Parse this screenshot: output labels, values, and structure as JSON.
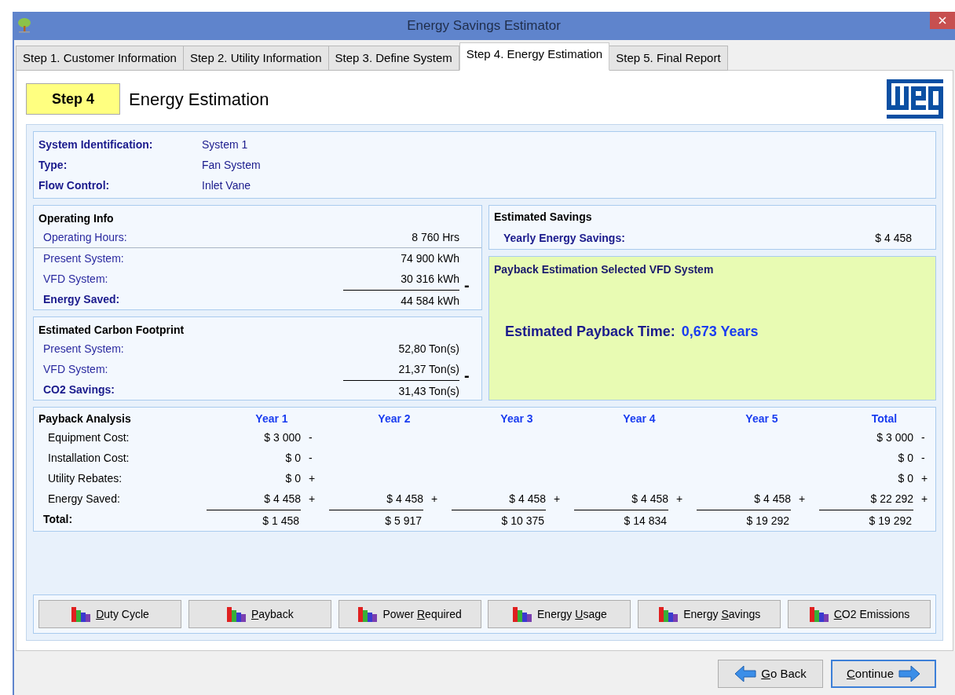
{
  "window": {
    "title": "Energy Savings Estimator"
  },
  "tabs": [
    {
      "label": "Step 1. Customer Information",
      "selected": false
    },
    {
      "label": "Step 2. Utility Information",
      "selected": false
    },
    {
      "label": "Step 3. Define System",
      "selected": false
    },
    {
      "label": "Step 4. Energy Estimation",
      "selected": true
    },
    {
      "label": "Step 5. Final Report",
      "selected": false
    }
  ],
  "header": {
    "badge": "Step 4",
    "title": "Energy Estimation"
  },
  "system": [
    {
      "label": "System Identification:",
      "value": "System 1"
    },
    {
      "label": "Type:",
      "value": "Fan System"
    },
    {
      "label": "Flow Control:",
      "value": "Inlet Vane"
    }
  ],
  "operating_info": {
    "title": "Operating Info",
    "hours": {
      "label": "Operating Hours:",
      "value": "8 760 Hrs"
    },
    "rows": [
      {
        "kind": "value",
        "label": "Present System:",
        "value": "74 900 kWh"
      },
      {
        "kind": "value",
        "label": "VFD System:",
        "value": "30 316 kWh"
      },
      {
        "kind": "result",
        "label": "Energy Saved:",
        "value": "44 584 kWh",
        "operator": "-"
      }
    ]
  },
  "carbon_footprint": {
    "title": "Estimated Carbon Footprint",
    "rows": [
      {
        "kind": "value",
        "label": "Present System:",
        "value": "52,80 Ton(s)"
      },
      {
        "kind": "value",
        "label": "VFD System:",
        "value": "21,37 Ton(s)"
      },
      {
        "kind": "result",
        "label": "CO2 Savings:",
        "value": "31,43 Ton(s)",
        "operator": "-"
      }
    ]
  },
  "estimated_savings": {
    "title": "Estimated Savings",
    "label": "Yearly Energy Savings:",
    "value": "$ 4 458"
  },
  "payback_estimation": {
    "title": "Payback Estimation Selected VFD System",
    "label": "Estimated Payback Time:",
    "value": "0,673 Years"
  },
  "payback_analysis": {
    "title": "Payback Analysis",
    "columns": [
      "Year 1",
      "Year 2",
      "Year 3",
      "Year 4",
      "Year 5",
      "Total"
    ],
    "rows": [
      {
        "kind": "value",
        "label": "Equipment Cost:",
        "cells": [
          {
            "value": "$ 3 000",
            "sign": "-"
          },
          null,
          null,
          null,
          null,
          {
            "value": "$ 3 000",
            "sign": "-"
          }
        ]
      },
      {
        "kind": "value",
        "label": "Installation Cost:",
        "cells": [
          {
            "value": "$ 0",
            "sign": "-"
          },
          null,
          null,
          null,
          null,
          {
            "value": "$ 0",
            "sign": "-"
          }
        ]
      },
      {
        "kind": "value",
        "label": "Utility Rebates:",
        "cells": [
          {
            "value": "$ 0",
            "sign": "+"
          },
          null,
          null,
          null,
          null,
          {
            "value": "$ 0",
            "sign": "+"
          }
        ]
      },
      {
        "kind": "value",
        "label": "Energy Saved:",
        "cells": [
          {
            "value": "$ 4 458",
            "sign": "+"
          },
          {
            "value": "$ 4 458",
            "sign": "+"
          },
          {
            "value": "$ 4 458",
            "sign": "+"
          },
          {
            "value": "$ 4 458",
            "sign": "+"
          },
          {
            "value": "$ 4 458",
            "sign": "+"
          },
          {
            "value": "$ 22 292",
            "sign": "+"
          }
        ]
      },
      {
        "kind": "result",
        "label": "Total:",
        "cells": [
          {
            "value": "$ 1 458"
          },
          {
            "value": "$ 5 917"
          },
          {
            "value": "$ 10 375"
          },
          {
            "value": "$ 14 834"
          },
          {
            "value": "$ 19 292"
          },
          {
            "value": "$ 19 292"
          }
        ]
      }
    ]
  },
  "chart_buttons": [
    {
      "label": {
        "key": "D",
        "after": "uty Cycle"
      }
    },
    {
      "label": {
        "key": "P",
        "after": "ayback"
      }
    },
    {
      "label": {
        "before": "Power ",
        "key": "R",
        "after": "equired"
      }
    },
    {
      "label": {
        "before": "Energy ",
        "key": "U",
        "after": "sage"
      }
    },
    {
      "label": {
        "before": "Energy ",
        "key": "S",
        "after": "avings"
      }
    },
    {
      "label": {
        "key": "C",
        "after": "O2 Emissions"
      }
    }
  ],
  "footer_buttons": [
    {
      "kind": "back",
      "label": {
        "key": "G",
        "after": "o Back"
      },
      "focused": false
    },
    {
      "kind": "next",
      "label": {
        "key": "C",
        "after": "ontinue"
      },
      "focused": true
    }
  ]
}
